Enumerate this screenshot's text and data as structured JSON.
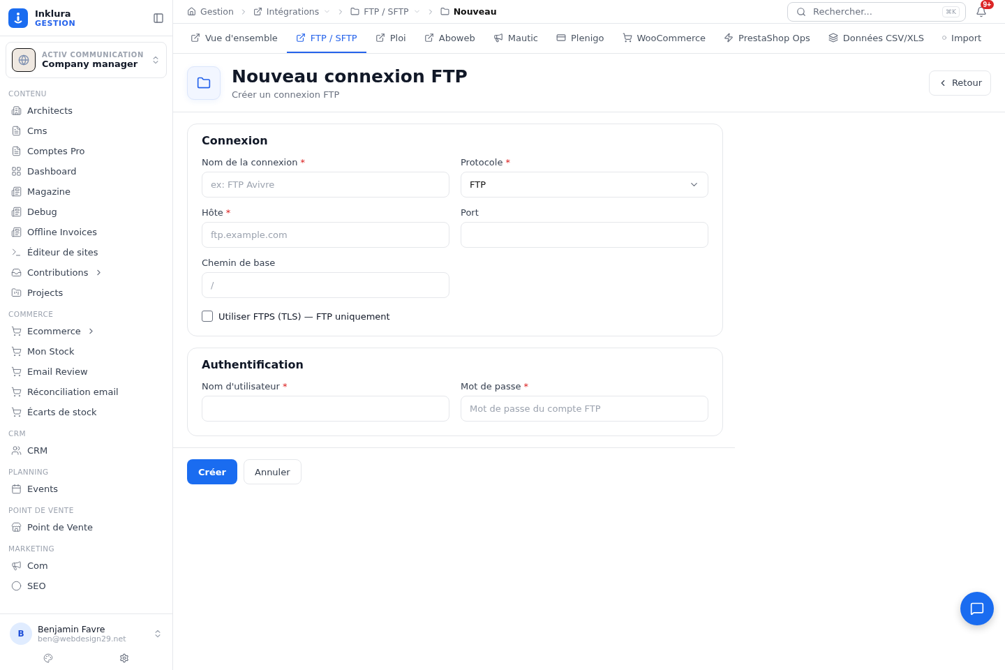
{
  "brand": {
    "name": "Inklura",
    "subtitle": "GESTION"
  },
  "workspace": {
    "company": "ACTIV COMMUNICATION",
    "role": "Company manager"
  },
  "sidebar": {
    "sections": [
      {
        "title": "CONTENU",
        "items": [
          {
            "label": "Architects",
            "expandable": false
          },
          {
            "label": "Cms",
            "expandable": false
          },
          {
            "label": "Comptes Pro",
            "expandable": false
          },
          {
            "label": "Dashboard",
            "expandable": false
          },
          {
            "label": "Magazine",
            "expandable": false
          },
          {
            "label": "Debug",
            "expandable": false
          },
          {
            "label": "Offline Invoices",
            "expandable": false
          },
          {
            "label": "Éditeur de sites",
            "expandable": false
          },
          {
            "label": "Contributions",
            "expandable": true
          },
          {
            "label": "Projects",
            "expandable": false
          }
        ]
      },
      {
        "title": "COMMERCE",
        "items": [
          {
            "label": "Ecommerce",
            "expandable": true
          },
          {
            "label": "Mon Stock",
            "expandable": false
          },
          {
            "label": "Email Review",
            "expandable": false
          },
          {
            "label": "Réconciliation email",
            "expandable": false
          },
          {
            "label": "Écarts de stock",
            "expandable": false
          }
        ]
      },
      {
        "title": "CRM",
        "items": [
          {
            "label": "CRM",
            "expandable": false
          }
        ]
      },
      {
        "title": "PLANNING",
        "items": [
          {
            "label": "Events",
            "expandable": false
          }
        ]
      },
      {
        "title": "POINT DE VENTE",
        "items": [
          {
            "label": "Point de Vente",
            "expandable": false
          }
        ]
      },
      {
        "title": "MARKETING",
        "items": [
          {
            "label": "Com",
            "expandable": false
          },
          {
            "label": "SEO",
            "expandable": false
          }
        ]
      }
    ]
  },
  "user": {
    "initial": "B",
    "name": "Benjamin Favre",
    "email": "ben@webdesign29.net"
  },
  "breadcrumb": [
    {
      "label": "Gestion",
      "dropdown": false,
      "current": false
    },
    {
      "label": "Intégrations",
      "dropdown": true,
      "current": false
    },
    {
      "label": "FTP / SFTP",
      "dropdown": true,
      "current": false
    },
    {
      "label": "Nouveau",
      "dropdown": false,
      "current": true
    }
  ],
  "search": {
    "placeholder": "Rechercher...",
    "shortcut": "⌘K"
  },
  "notifications": {
    "badge": "9+"
  },
  "tabs": [
    {
      "label": "Vue d'ensemble",
      "selected": false
    },
    {
      "label": "FTP / SFTP",
      "selected": true
    },
    {
      "label": "Ploi",
      "selected": false
    },
    {
      "label": "Aboweb",
      "selected": false
    },
    {
      "label": "Mautic",
      "selected": false
    },
    {
      "label": "Plenigo",
      "selected": false
    },
    {
      "label": "WooCommerce",
      "selected": false
    },
    {
      "label": "PrestaShop Ops",
      "selected": false
    },
    {
      "label": "Données CSV/XLS",
      "selected": false
    },
    {
      "label": "Import",
      "selected": false
    }
  ],
  "page": {
    "title": "Nouveau connexion FTP",
    "subtitle": "Créer un connexion FTP",
    "back": "Retour"
  },
  "cards": [
    {
      "title": "Connexion",
      "fields": [
        {
          "kind": "text",
          "label": "Nom de la connexion",
          "required_mark": "*",
          "placeholder": "ex: FTP Avivre"
        },
        {
          "kind": "select",
          "label": "Protocole",
          "required_mark": "*",
          "value": "FTP"
        },
        {
          "kind": "text",
          "label": "Hôte",
          "required_mark": "*",
          "placeholder": "ftp.example.com"
        },
        {
          "kind": "text",
          "label": "Port"
        },
        {
          "kind": "text",
          "label": "Chemin de base",
          "placeholder": "/"
        }
      ],
      "checkbox": {
        "label": "Utiliser FTPS (TLS) — FTP uniquement",
        "checked": false
      }
    },
    {
      "title": "Authentification",
      "fields": [
        {
          "kind": "text",
          "label": "Nom d'utilisateur",
          "required_mark": "*"
        },
        {
          "kind": "password",
          "label": "Mot de passe",
          "required_mark": "*",
          "placeholder": "Mot de passe du compte FTP"
        }
      ]
    }
  ],
  "actions": {
    "submit": "Créer",
    "cancel": "Annuler"
  }
}
